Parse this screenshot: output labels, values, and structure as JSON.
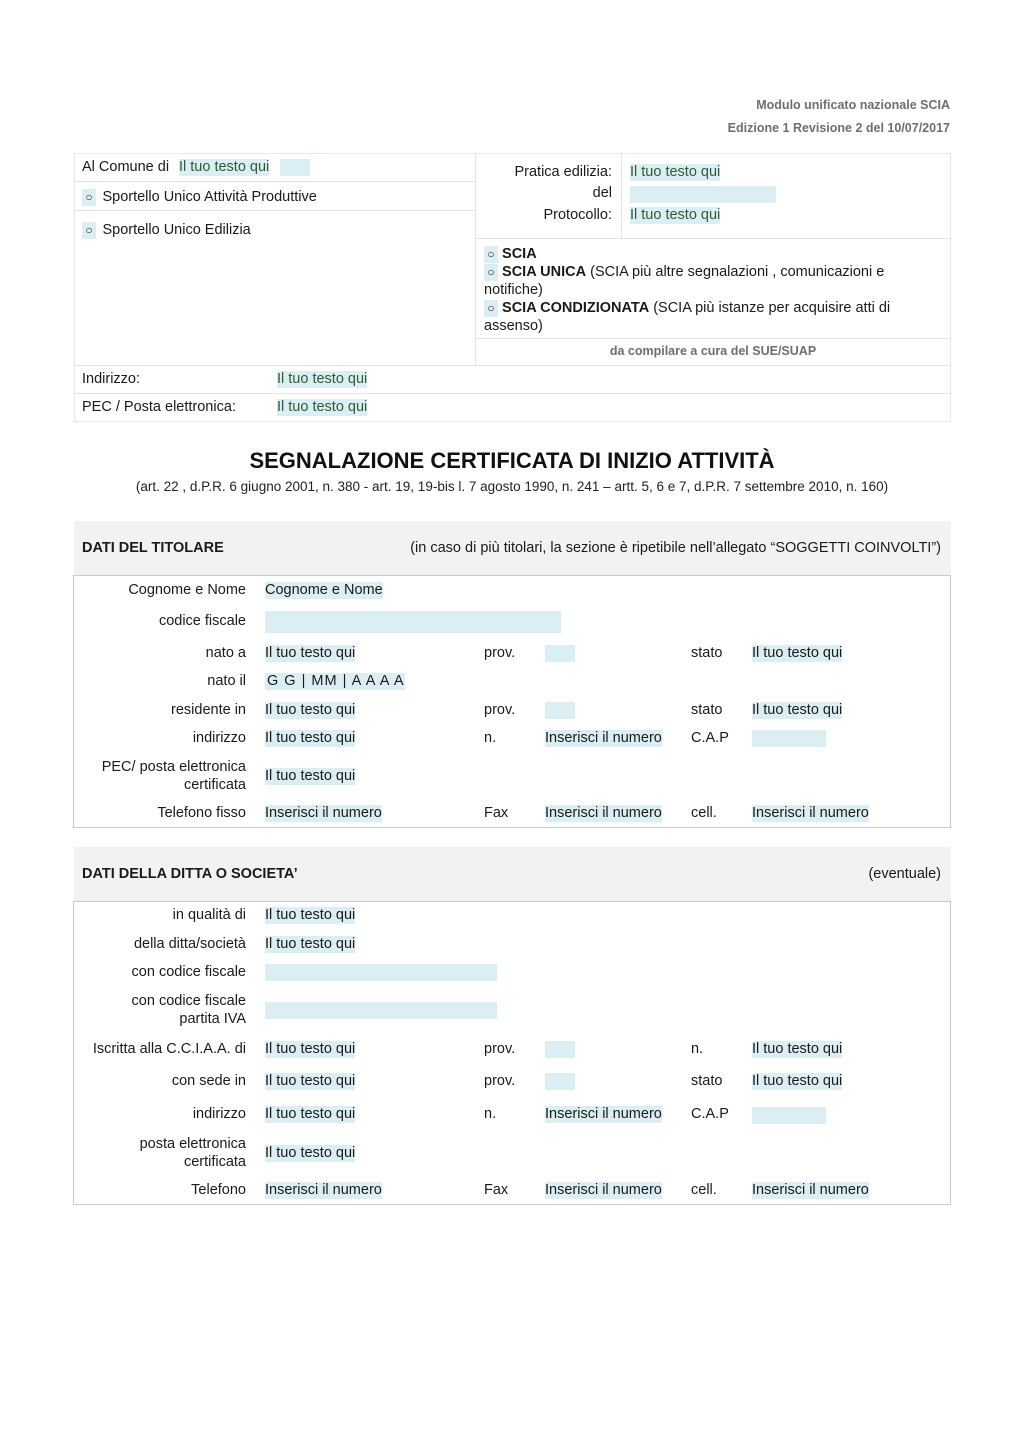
{
  "header": {
    "line1": "Modulo unificato nazionale SCIA",
    "line2": "Edizione 1 Revisione 2 del 10/07/2017"
  },
  "top": {
    "comune_label": "Al Comune di",
    "comune_value": "Il tuo testo qui",
    "opt_suap": "Sportello Unico Attività Produttive",
    "opt_sue": "Sportello Unico Edilizia",
    "radio_glyph": "○",
    "pratica_label": "Pratica edilizia:",
    "pratica_value": "Il tuo testo qui",
    "del_label": "del",
    "protocollo_label": "Protocollo:",
    "protocollo_value": "Il tuo testo qui",
    "scia_options": [
      {
        "bold": "SCIA",
        "rest": ""
      },
      {
        "bold": "SCIA UNICA",
        "rest": " (SCIA più altre segnalazioni , comunicazioni e notifiche)"
      },
      {
        "bold": "SCIA CONDIZIONATA",
        "rest": " (SCIA più istanze per acquisire atti di assenso)"
      }
    ],
    "compile_note": "da compilare a cura del SUE/SUAP",
    "indirizzo_label": "Indirizzo:",
    "indirizzo_value": "Il tuo testo qui",
    "pec_label": "PEC / Posta elettronica:",
    "pec_value": "Il tuo testo qui"
  },
  "doc_title": "SEGNALAZIONE CERTIFICATA DI INIZIO ATTIVITÀ",
  "doc_subtitle": "(art. 22 , d.P.R. 6 giugno 2001, n. 380 - art. 19, 19-bis l. 7 agosto 1990, n. 241 – artt. 5, 6 e 7, d.P.R. 7 settembre 2010, n. 160)",
  "titolare": {
    "title": "DATI DEL TITOLARE",
    "note": "(in caso di più titolari, la sezione è ripetibile nell’allegato “SOGGETTI COINVOLTI”)",
    "cognome_label": "Cognome e Nome",
    "cognome_value": "Cognome e Nome",
    "cf_label": "codice fiscale",
    "nato_a_label": "nato a",
    "nato_a_value": "Il tuo testo qui",
    "prov_label": "prov.",
    "stato_label": "stato",
    "stato_value": "Il tuo testo qui",
    "nato_il_label": "nato il",
    "nato_il_value": "G G | MM | A A A A",
    "residente_label": "residente in",
    "residente_value": "Il tuo testo qui",
    "stato2_value": "Il tuo testo qui",
    "indirizzo_label": "indirizzo",
    "indirizzo_value": "Il tuo testo qui",
    "n_label": "n.",
    "n_value": "Inserisci il numero",
    "cap_label": "C.A.P",
    "pec_label_1": "PEC/ posta elettronica",
    "pec_label_2": "certificata",
    "pec_value": "Il tuo testo qui",
    "tel_label": "Telefono fisso",
    "tel_value": "Inserisci il numero",
    "fax_label": "Fax",
    "fax_value": "Inserisci il numero",
    "cell_label": "cell.",
    "cell_value": "Inserisci il numero"
  },
  "ditta": {
    "title": "DATI DELLA DITTA O SOCIETA’",
    "note": "(eventuale)",
    "qualita_label": "in qualità di",
    "qualita_value": "Il tuo testo qui",
    "ditta_label": "della ditta/società",
    "ditta_value": "Il tuo testo qui",
    "cf_label": "con codice fiscale",
    "piva_label_1": "con codice fiscale",
    "piva_label_2": "partita IVA",
    "cciaa_label": "Iscritta alla C.C.I.A.A. di",
    "cciaa_value": "Il tuo testo qui",
    "prov_label": "prov.",
    "n_label": "n.",
    "n_value": "Il tuo testo qui",
    "sede_label": "con sede in",
    "sede_value": "Il tuo testo qui",
    "stato_label": "stato",
    "stato_value": "Il tuo testo qui",
    "indirizzo_label": "indirizzo",
    "indirizzo_value": "Il tuo testo qui",
    "num_label": "n.",
    "num_value": "Inserisci il numero",
    "cap_label": "C.A.P",
    "pec_label_1": "posta elettronica",
    "pec_label_2": "certificata",
    "pec_value": "Il tuo testo qui",
    "tel_label": "Telefono",
    "tel_value": "Inserisci il numero",
    "fax_label": "Fax",
    "fax_value": "Inserisci il numero",
    "cell_label": "cell.",
    "cell_value": "Inserisci il numero"
  }
}
